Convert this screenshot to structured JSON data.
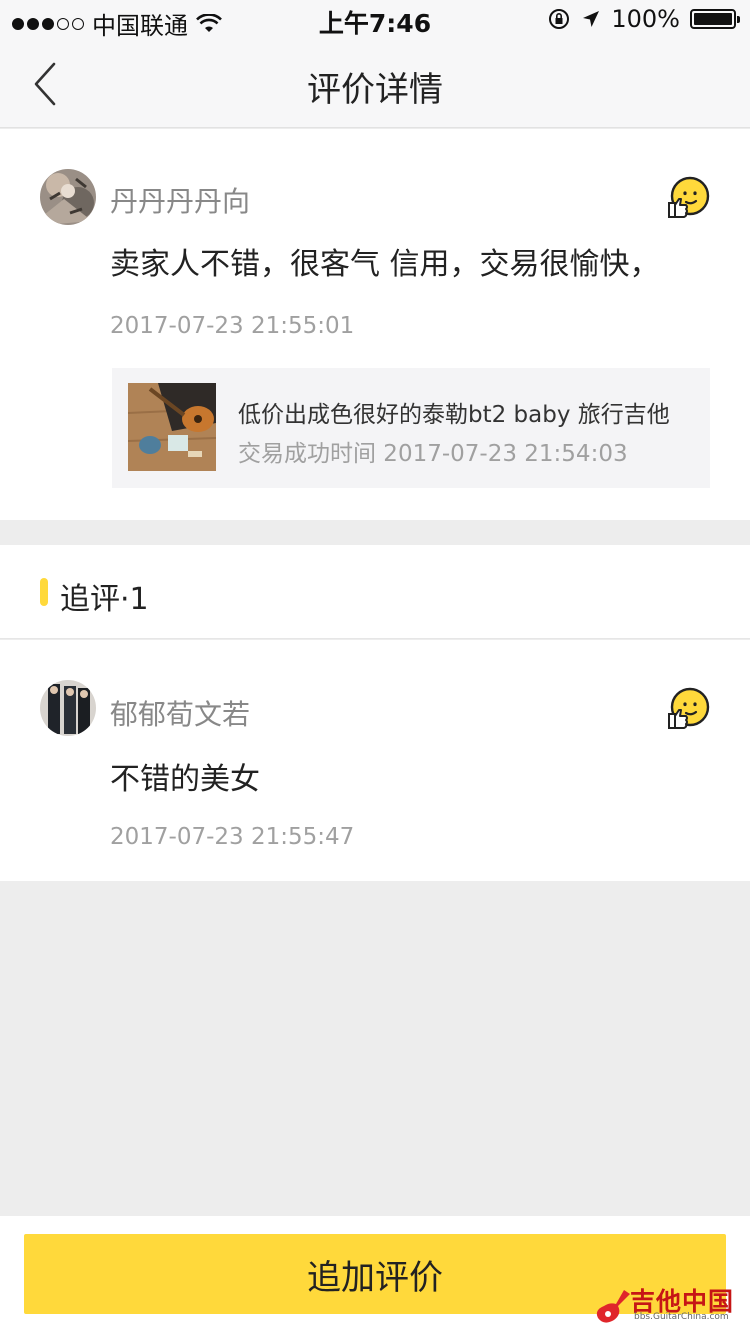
{
  "status_bar": {
    "carrier": "中国联通",
    "time": "上午7:46",
    "battery": "100%",
    "signal_bars_filled": 3,
    "signal_bars_total": 5
  },
  "nav": {
    "title": "评价详情"
  },
  "review": {
    "username": "丹丹丹丹向",
    "content": "卖家人不错，很客气 信用，交易很愉快，",
    "timestamp": "2017-07-23 21:55:01",
    "emoji": "thumbs-up-smile-icon",
    "product": {
      "title": "低价出成色很好的泰勒bt2  baby 旅行吉他",
      "deal_time": "交易成功时间 2017-07-23 21:54:03"
    }
  },
  "follow_up": {
    "header": "追评·1",
    "items": [
      {
        "username": "郁郁荀文若",
        "content": "不错的美女",
        "timestamp": "2017-07-23 21:55:47",
        "emoji": "thumbs-up-smile-icon"
      }
    ]
  },
  "bottom": {
    "button_label": "追加评价"
  },
  "watermark": {
    "title": "吉他中国",
    "subtitle": "bbs.GuitarChina.com"
  },
  "colors": {
    "accent": "#ffd93b",
    "background": "#ededed"
  }
}
